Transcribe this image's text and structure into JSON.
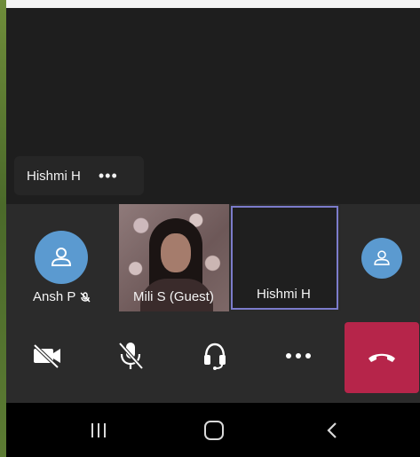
{
  "main_stage": {
    "speaker_name": "Hishmi H",
    "more_label": "•••"
  },
  "tiles": [
    {
      "name": "Ansh P",
      "muted": true,
      "avatar": "person-icon"
    },
    {
      "name": "Mili S (Guest)",
      "video": true
    },
    {
      "name": "Hishmi H",
      "active": true
    },
    {
      "avatar": "person-icon"
    }
  ],
  "controls": {
    "camera": "video-off-icon",
    "mic": "mic-off-icon",
    "audio": "headset-icon",
    "more": "more-icon",
    "hangup": "hang-up-icon",
    "hangup_color": "#b6254a",
    "active_border_color": "#7c7ccb",
    "avatar_color": "#5b9ad0"
  },
  "system_nav": {
    "recents": "recents-icon",
    "home": "home-icon",
    "back": "back-icon"
  }
}
